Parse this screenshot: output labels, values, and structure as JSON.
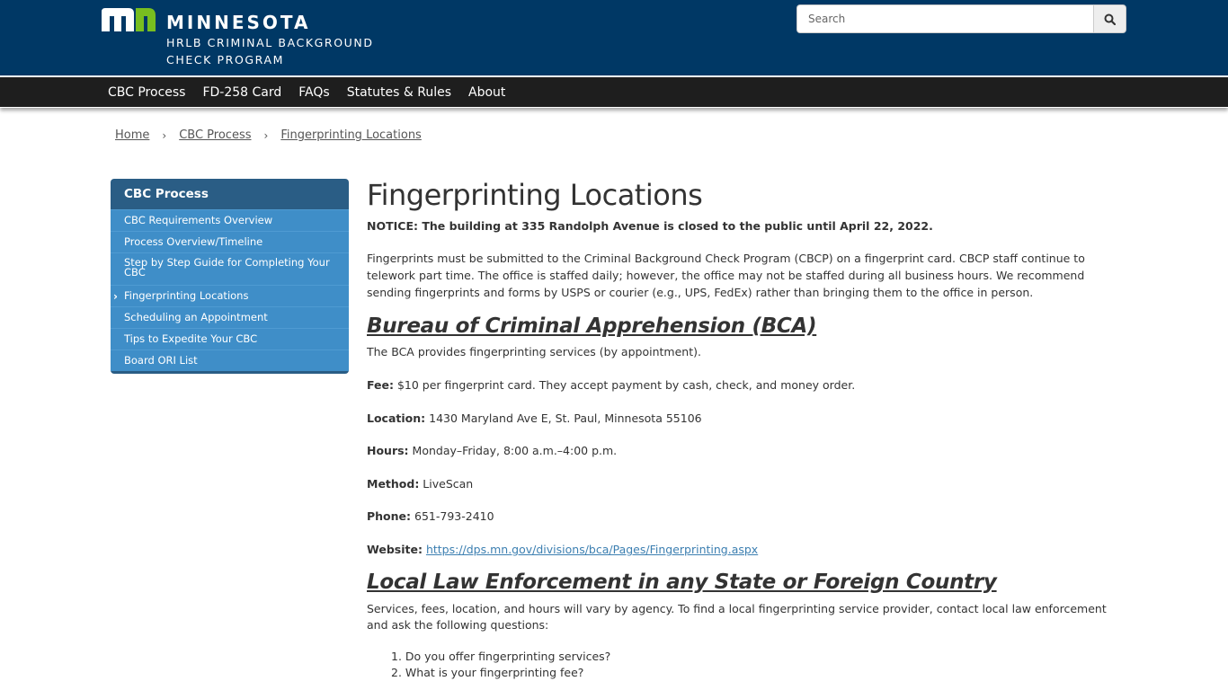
{
  "header": {
    "logo": {
      "state": "MINNESOTA",
      "program_line1": "HRLB CRIMINAL BACKGROUND",
      "program_line2": "CHECK PROGRAM",
      "mark_colors": {
        "m": "#ffffff",
        "n": "#78be20"
      }
    },
    "search": {
      "placeholder": "Search",
      "value": "",
      "button_icon": "search-icon"
    }
  },
  "nav": {
    "items": [
      {
        "label": "CBC Process"
      },
      {
        "label": "FD-258 Card"
      },
      {
        "label": "FAQs"
      },
      {
        "label": "Statutes & Rules"
      },
      {
        "label": "About"
      }
    ]
  },
  "breadcrumb": {
    "items": [
      {
        "label": "Home"
      },
      {
        "label": "CBC Process"
      },
      {
        "label": "Fingerprinting Locations"
      }
    ],
    "separator": "›"
  },
  "sidebar": {
    "title": "CBC Process",
    "items": [
      {
        "label": "CBC Requirements Overview",
        "active": false
      },
      {
        "label": "Process Overview/Timeline",
        "active": false
      },
      {
        "label": "Step by Step Guide for Completing Your CBC",
        "active": false
      },
      {
        "label": "Fingerprinting Locations",
        "active": true
      },
      {
        "label": "Scheduling an Appointment",
        "active": false
      },
      {
        "label": "Tips to Expedite Your CBC",
        "active": false
      },
      {
        "label": "Board ORI List",
        "active": false
      }
    ]
  },
  "main": {
    "title": "Fingerprinting Locations",
    "notice": "NOTICE: The building at 335 Randolph Avenue is closed to the public until April 22, 2022.",
    "intro": "Fingerprints must be submitted to the Criminal Background Check Program (CBCP) on a fingerprint card. CBCP staff continue to telework part time. The office is staffed daily; however, the office may not be staffed during all business hours. We recommend sending fingerprints and forms by USPS or courier (e.g., UPS, FedEx) rather than bringing them to the office in person.",
    "bca": {
      "heading": "Bureau of Criminal Apprehension (BCA)",
      "description": "The BCA provides fingerprinting services (by appointment).",
      "fields": {
        "fee": {
          "label": "Fee:",
          "value": " $10 per fingerprint card. They accept payment by cash, check, and money order."
        },
        "location": {
          "label": "Location:",
          "value": " 1430 Maryland Ave E, St. Paul, Minnesota 55106"
        },
        "hours": {
          "label": "Hours:",
          "value": " Monday–Friday, 8:00 a.m.–4:00 p.m."
        },
        "method": {
          "label": "Method:",
          "value": " LiveScan"
        },
        "phone": {
          "label": "Phone:",
          "value": " 651-793-2410"
        },
        "website": {
          "label": "Website:",
          "value": "https://dps.mn.gov/divisions/bca/Pages/Fingerprinting.aspx"
        }
      }
    },
    "local": {
      "heading": "Local Law Enforcement in any State or Foreign Country",
      "description": "Services, fees, location, and hours will vary by agency. To find a local fingerprinting service provider, contact local law enforcement and ask the following questions:",
      "questions": [
        "Do you offer fingerprinting services?",
        "What is your fingerprinting fee?"
      ]
    }
  }
}
